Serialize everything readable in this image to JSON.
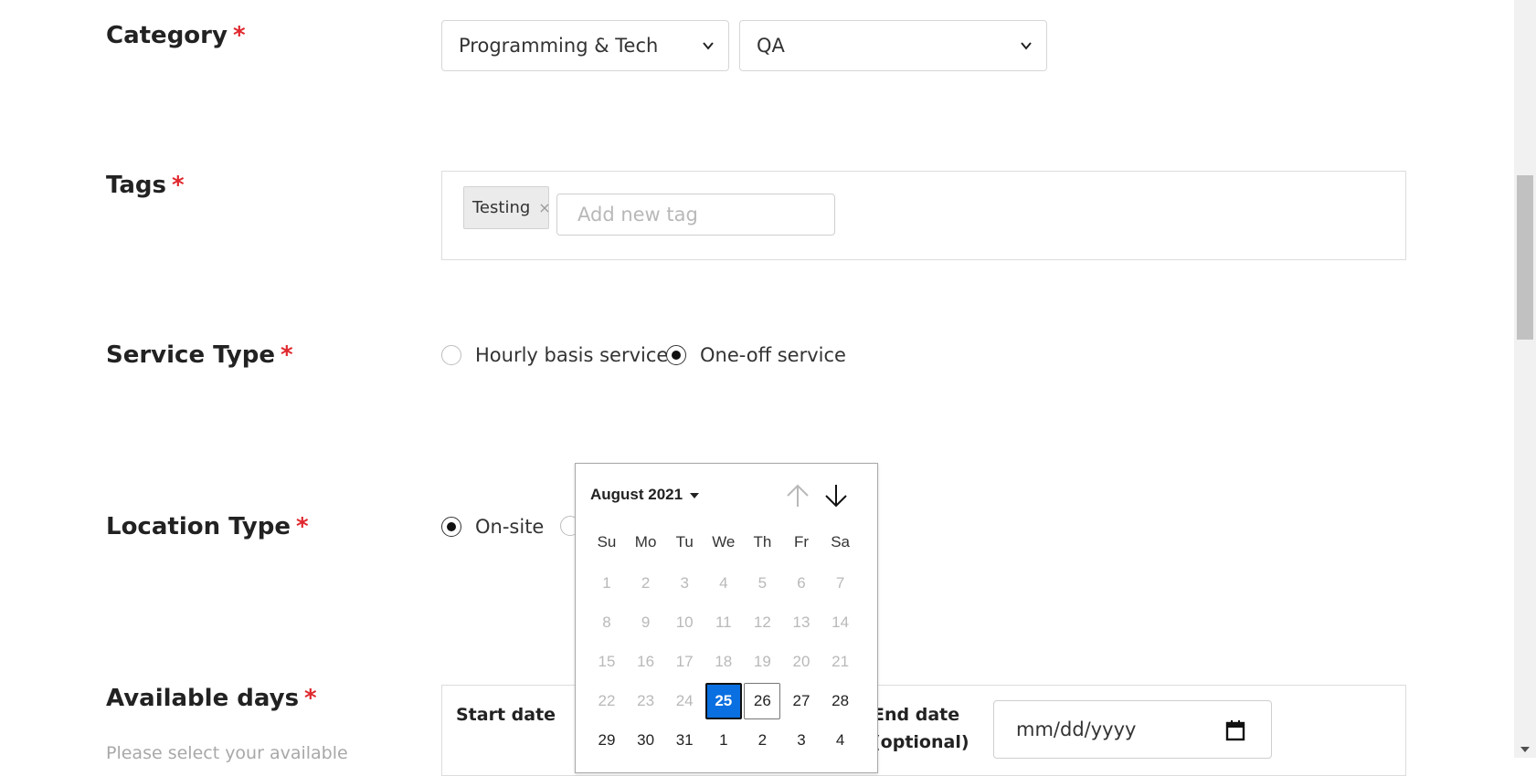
{
  "category": {
    "label": "Category",
    "required_mark": "*",
    "primary_value": "Programming & Tech",
    "secondary_value": "QA"
  },
  "tags": {
    "label": "Tags",
    "required_mark": "*",
    "chips": [
      {
        "text": "Testing",
        "remove": "×"
      }
    ],
    "input_placeholder": "Add new tag"
  },
  "service_type": {
    "label": "Service Type",
    "required_mark": "*",
    "options": [
      {
        "text": "Hourly basis service",
        "selected": false
      },
      {
        "text": "One-off service",
        "selected": true
      }
    ]
  },
  "location_type": {
    "label": "Location Type",
    "required_mark": "*",
    "options": [
      {
        "text": "On-site",
        "selected": true
      }
    ]
  },
  "available_days": {
    "label": "Available days",
    "required_mark": "*",
    "helper": "Please select your available",
    "start_label": "Start date",
    "end_label_line1": "End date",
    "end_label_line2": "(optional)",
    "end_placeholder": "mm/dd/yyyy"
  },
  "datepicker": {
    "month_label": "August 2021",
    "weekdays": [
      "Su",
      "Mo",
      "Tu",
      "We",
      "Th",
      "Fr",
      "Sa"
    ],
    "weeks": [
      [
        "1",
        "2",
        "3",
        "4",
        "5",
        "6",
        "7"
      ],
      [
        "8",
        "9",
        "10",
        "11",
        "12",
        "13",
        "14"
      ],
      [
        "15",
        "16",
        "17",
        "18",
        "19",
        "20",
        "21"
      ],
      [
        "22",
        "23",
        "24",
        "25",
        "26",
        "27",
        "28"
      ],
      [
        "29",
        "30",
        "31",
        "1",
        "2",
        "3",
        "4"
      ]
    ],
    "selected_day": "25",
    "today_day": "26",
    "first_enabled_day": "25",
    "colors": {
      "selected": "#0a6fe0",
      "disabled_text": "#b9b9b9"
    }
  },
  "icons": [
    "chevron-down-icon",
    "close-icon",
    "arrow-up-icon",
    "arrow-down-icon",
    "calendar-icon",
    "caret-down-icon"
  ]
}
